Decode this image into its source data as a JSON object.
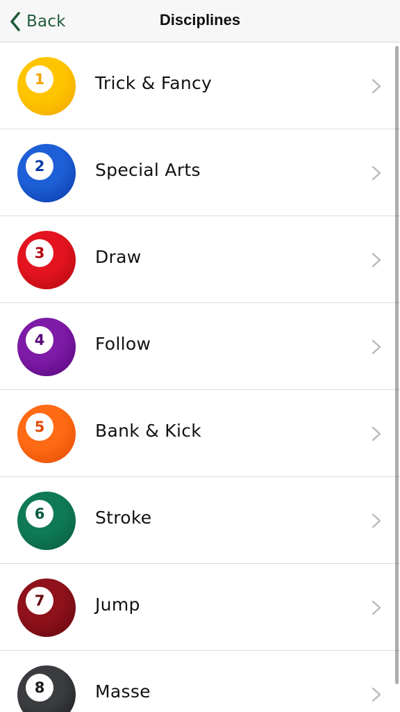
{
  "navbar": {
    "back_label": "Back",
    "title": "Disciplines"
  },
  "colors": {
    "accent": "#1f5b3a"
  },
  "disciplines": [
    {
      "number": "1",
      "label": "Trick & Fancy",
      "color": "#ffc400",
      "dark": "#f0a500"
    },
    {
      "number": "2",
      "label": "Special Arts",
      "color": "#1d5fd6",
      "dark": "#0a3aa6"
    },
    {
      "number": "3",
      "label": "Draw",
      "color": "#e3141f",
      "dark": "#b0070f"
    },
    {
      "number": "4",
      "label": "Follow",
      "color": "#7d1aa6",
      "dark": "#55067a"
    },
    {
      "number": "5",
      "label": "Bank & Kick",
      "color": "#ff6a14",
      "dark": "#e04c05"
    },
    {
      "number": "6",
      "label": "Stroke",
      "color": "#0f7a55",
      "dark": "#075a3d"
    },
    {
      "number": "7",
      "label": "Jump",
      "color": "#8e111b",
      "dark": "#62070e"
    },
    {
      "number": "8",
      "label": "Masse",
      "color": "#3a3c40",
      "dark": "#1a1b1d"
    }
  ]
}
